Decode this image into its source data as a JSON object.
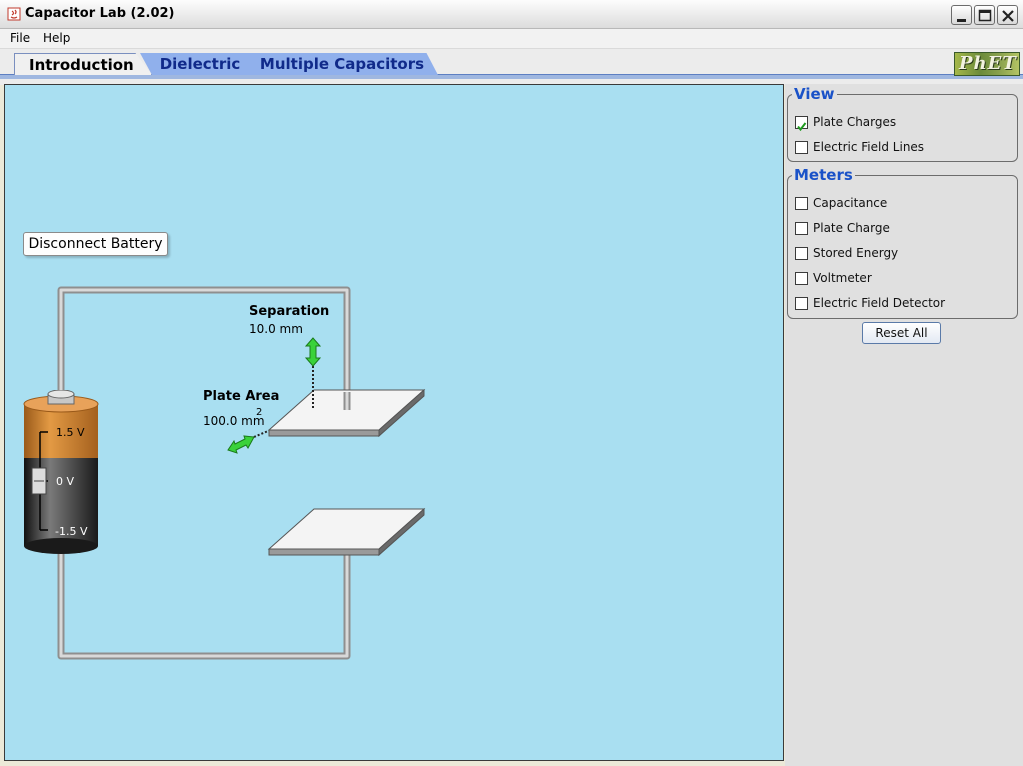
{
  "window": {
    "title": "Capacitor Lab (2.02)",
    "controls": [
      "minimize-icon",
      "maximize-icon",
      "close-icon"
    ]
  },
  "menu": {
    "file": "File",
    "help": "Help"
  },
  "tabs": [
    {
      "label": "Introduction",
      "selected": true
    },
    {
      "label": "Dielectric",
      "selected": false
    },
    {
      "label": "Multiple Capacitors",
      "selected": false
    }
  ],
  "logo": {
    "text": "PhET"
  },
  "play": {
    "disconnect_button": "Disconnect Battery",
    "separation": {
      "label": "Separation",
      "value": "10.0 mm"
    },
    "plate_area": {
      "label": "Plate Area",
      "value": "100.0 mm",
      "superscript": "2"
    },
    "battery": {
      "max_label": "1.5 V",
      "zero_label": "0 V",
      "min_label": "-1.5 V",
      "level_volts": 0
    },
    "colors": {
      "background": "#a9dff1",
      "arrow": "#3ad23a",
      "battery_top": "#d2802c",
      "battery_body": "#2b2b2b"
    }
  },
  "view_panel": {
    "title": "View",
    "items": [
      {
        "label": "Plate Charges",
        "checked": true
      },
      {
        "label": "Electric Field Lines",
        "checked": false
      }
    ]
  },
  "meters_panel": {
    "title": "Meters",
    "items": [
      {
        "label": "Capacitance",
        "checked": false
      },
      {
        "label": "Plate Charge",
        "checked": false
      },
      {
        "label": "Stored Energy",
        "checked": false
      },
      {
        "label": "Voltmeter",
        "checked": false
      },
      {
        "label": "Electric Field Detector",
        "checked": false
      }
    ]
  },
  "reset_button": "Reset All"
}
